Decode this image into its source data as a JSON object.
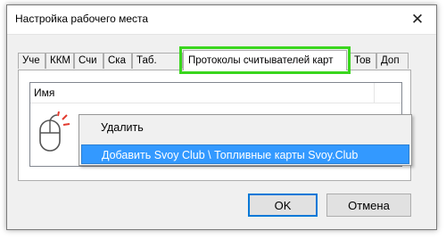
{
  "window": {
    "title": "Настройка рабочего места",
    "close_glyph": "✕"
  },
  "tabs": [
    {
      "label": "Уче",
      "active": false
    },
    {
      "label": "ККМ",
      "active": false
    },
    {
      "label": "Счи",
      "active": false
    },
    {
      "label": "Ска",
      "active": false
    },
    {
      "label": "Таб.",
      "active": false
    },
    {
      "label": "Протоколы считывателей карт",
      "active": true
    },
    {
      "label": "Тов",
      "active": false
    },
    {
      "label": "Доп",
      "active": false
    }
  ],
  "list": {
    "column_name": "Имя"
  },
  "context_menu": {
    "items": [
      {
        "label": "Удалить",
        "highlighted": false
      },
      {
        "label": "Добавить Svoy Club \\ Топливные карты Svoy.Club",
        "highlighted": true
      }
    ]
  },
  "buttons": {
    "ok": "OK",
    "cancel": "Отмена"
  },
  "colors": {
    "highlight": "#3399ff",
    "tab_outline": "#3ad61e",
    "mouse_click_mark": "#e23b2f"
  },
  "icons": {
    "mouse": "mouse-right-click-icon",
    "close": "close-icon"
  }
}
